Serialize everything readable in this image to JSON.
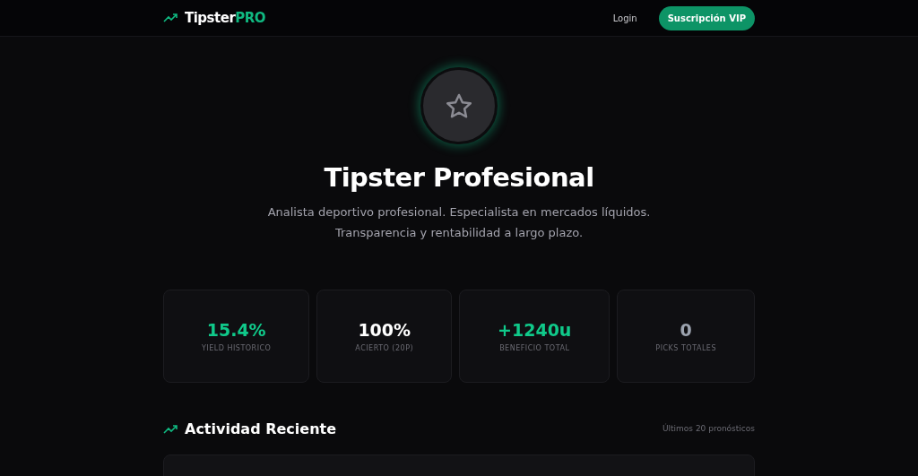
{
  "navbar": {
    "brand": "Tipster",
    "brand_accent": "PRO",
    "links": [
      {
        "label": "Login",
        "kind": "link"
      },
      {
        "label": "Suscripción VIP",
        "kind": "button"
      }
    ]
  },
  "profile": {
    "name": "Tipster Profesional",
    "bio": [
      "Analista deportivo profesional. Especialista en mercados líquidos.",
      "Transparencia y rentabilidad a largo plazo."
    ]
  },
  "stats": [
    {
      "value": "15.4%",
      "label": "YIELD HISTORICO",
      "color": "#10c98a"
    },
    {
      "value": "100%",
      "label": "ACIERTO (20P)",
      "color": "#ffffff"
    },
    {
      "value": "+1240u",
      "label": "BENEFICIO TOTAL",
      "color": "#10c98a"
    },
    {
      "value": "0",
      "label": "PICKS TOTALES",
      "color": "#9ca3af"
    }
  ],
  "activity": {
    "title": "Actividad Reciente",
    "note": "Últimos 20 pronósticos"
  }
}
